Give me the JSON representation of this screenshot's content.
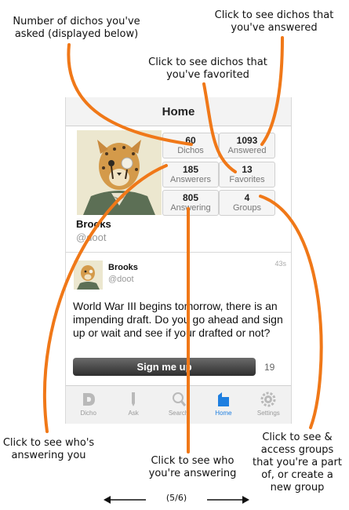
{
  "annotations": {
    "asked": "Number of dichos you've asked (displayed below)",
    "answered": "Click to see dichos that you've answered",
    "favorited": "Click to see dichos that you've favorited",
    "answering_you": "Click to see who's answering you",
    "you_answering": "Click to see who you're answering",
    "groups": "Click to see & access groups that you're a part of, or create a new group"
  },
  "navbar": {
    "title": "Home"
  },
  "profile": {
    "name": "Brooks",
    "handle": "@doot",
    "stats": {
      "asked": {
        "count": "60",
        "label": "Dichos"
      },
      "answered": {
        "count": "1093",
        "label": "Answered"
      },
      "answerers": {
        "count": "185",
        "label": "Answerers"
      },
      "favorites": {
        "count": "13",
        "label": "Favorites"
      },
      "answering": {
        "count": "805",
        "label": "Answering"
      },
      "groups": {
        "count": "4",
        "label": "Groups"
      }
    }
  },
  "feed": {
    "item": {
      "name": "Brooks",
      "handle": "@doot",
      "time": "43s",
      "question": "World War III begins tomorrow, there is an impending draft. Do you go ahead and sign up or wait and see if your drafted or not?",
      "button_label": "Sign me up",
      "count": "19"
    }
  },
  "tabbar": {
    "items": [
      {
        "label": "Dicho",
        "icon": "dicho-logo-icon"
      },
      {
        "label": "Ask",
        "icon": "pencil-icon"
      },
      {
        "label": "Search",
        "icon": "search-icon"
      },
      {
        "label": "Home",
        "icon": "home-icon",
        "active": true
      },
      {
        "label": "Settings",
        "icon": "gear-icon"
      }
    ]
  },
  "pager": {
    "label": "(5/6)"
  },
  "colors": {
    "annotation_line": "#f07818",
    "active_tab": "#1e7fe0",
    "button": "#3b3b3b"
  }
}
